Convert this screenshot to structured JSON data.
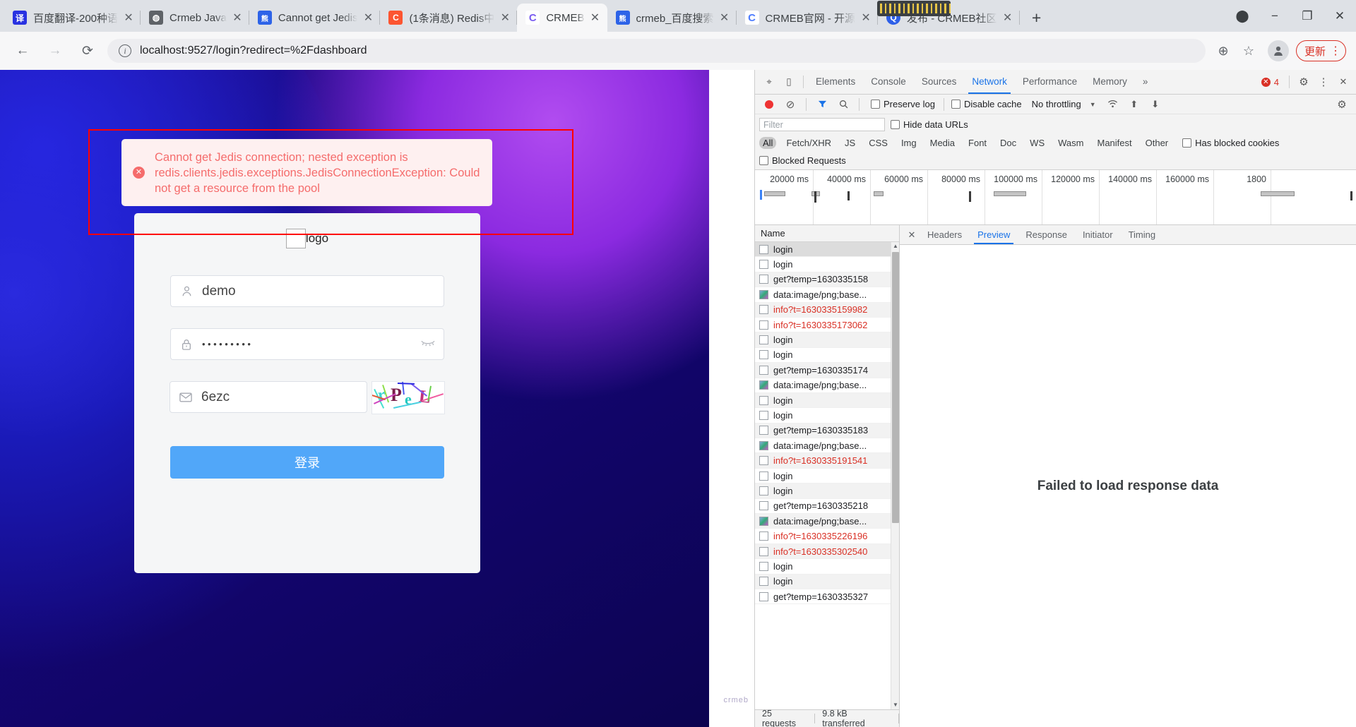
{
  "browser": {
    "tabs": [
      {
        "title": "百度翻译-200种语",
        "favicon_text": "译",
        "favicon_color": "#2932e1",
        "active": false
      },
      {
        "title": "Crmeb Java",
        "favicon_text": "◍",
        "favicon_color": "#5f6368",
        "active": false
      },
      {
        "title": "Cannot get Jedis",
        "favicon_text": "熊",
        "favicon_color": "#2d63e8",
        "active": false
      },
      {
        "title": "(1条消息) Redis中",
        "favicon_text": "C",
        "favicon_color": "#fc5531",
        "active": false
      },
      {
        "title": "CRMEB",
        "favicon_text": "C",
        "favicon_color": "#7a5cf0",
        "active": true
      },
      {
        "title": "crmeb_百度搜索",
        "favicon_text": "熊",
        "favicon_color": "#2d63e8",
        "active": false
      },
      {
        "title": "CRMEB官网 - 开源",
        "favicon_text": "C",
        "favicon_color": "#4d7cfe",
        "active": false
      },
      {
        "title": "发布 - CRMEB社区",
        "favicon_text": "Q",
        "favicon_color": "#2d5fe8",
        "active": false
      }
    ],
    "new_tab_label": "+",
    "close_label": "✕",
    "window_controls": {
      "extension": "⬤",
      "minimize": "−",
      "maximize": "❐",
      "close": "✕"
    },
    "nav": {
      "back": "←",
      "forward": "→",
      "reload": "⟳",
      "info_icon": "i",
      "url": "localhost:9527/login?redirect=%2Fdashboard",
      "zoom_icon": "⊕",
      "bookmark_icon": "☆",
      "profile_icon": "👤",
      "update_label": "更新",
      "menu_icon": "⋮"
    }
  },
  "page": {
    "toast": {
      "icon": "✕",
      "message": "Cannot get Jedis connection; nested exception is redis.clients.jedis.exceptions.JedisConnectionException: Could not get a resource from the pool",
      "text_color": "#f56c6c",
      "bg_color": "#fef0f0",
      "highlight_border": "#ff0000"
    },
    "login": {
      "logo_alt": "logo",
      "username": {
        "icon": "user-icon",
        "value": "demo"
      },
      "password": {
        "icon": "lock-icon",
        "value": "•••••••••",
        "toggle_icon": "eye-off-icon"
      },
      "captcha": {
        "icon": "mail-icon",
        "value": "6ezc",
        "image_text": "rPeL"
      },
      "submit_label": "登录",
      "submit_color": "#51a7f9"
    },
    "watermark": "crmeb"
  },
  "devtools": {
    "inspect_icon": "⌖",
    "device_icon": "▯",
    "tabs": [
      {
        "label": "Elements",
        "active": false
      },
      {
        "label": "Console",
        "active": false
      },
      {
        "label": "Sources",
        "active": false
      },
      {
        "label": "Network",
        "active": true
      },
      {
        "label": "Performance",
        "active": false
      },
      {
        "label": "Memory",
        "active": false
      }
    ],
    "more_tabs_icon": "»",
    "error_count": "4",
    "error_dot": "✕",
    "settings_icon": "⚙",
    "menu_icon": "⋮",
    "close_icon": "✕",
    "controls": {
      "record_title": "record",
      "clear_icon": "⊘",
      "filter_icon": "▼",
      "search_icon": "🔍",
      "preserve_log": "Preserve log",
      "disable_cache": "Disable cache",
      "throttling": "No throttling",
      "throttling_caret": "▼",
      "wifi_icon": "((•))",
      "upload_icon": "⬆",
      "download_icon": "⬇",
      "net_settings_icon": "⚙"
    },
    "filter": {
      "placeholder": "Filter",
      "hide_data_urls": "Hide data URLs",
      "blocked_requests": "Blocked Requests",
      "has_blocked_cookies": "Has blocked cookies"
    },
    "types": [
      "All",
      "Fetch/XHR",
      "JS",
      "CSS",
      "Img",
      "Media",
      "Font",
      "Doc",
      "WS",
      "Wasm",
      "Manifest",
      "Other"
    ],
    "overview": {
      "ticks": [
        "20000 ms",
        "40000 ms",
        "60000 ms",
        "80000 ms",
        "100000 ms",
        "120000 ms",
        "140000 ms",
        "160000 ms",
        "1800"
      ]
    },
    "requests": {
      "column_header": "Name",
      "rows": [
        {
          "name": "login",
          "kind": "doc",
          "error": false,
          "selected": true
        },
        {
          "name": "login",
          "kind": "doc",
          "error": false
        },
        {
          "name": "get?temp=1630335158",
          "kind": "doc",
          "error": false
        },
        {
          "name": "data:image/png;base...",
          "kind": "img",
          "error": false
        },
        {
          "name": "info?t=1630335159982",
          "kind": "doc",
          "error": true
        },
        {
          "name": "info?t=1630335173062",
          "kind": "doc",
          "error": true
        },
        {
          "name": "login",
          "kind": "doc",
          "error": false
        },
        {
          "name": "login",
          "kind": "doc",
          "error": false
        },
        {
          "name": "get?temp=1630335174",
          "kind": "doc",
          "error": false
        },
        {
          "name": "data:image/png;base...",
          "kind": "img",
          "error": false
        },
        {
          "name": "login",
          "kind": "doc",
          "error": false
        },
        {
          "name": "login",
          "kind": "doc",
          "error": false
        },
        {
          "name": "get?temp=1630335183",
          "kind": "doc",
          "error": false
        },
        {
          "name": "data:image/png;base...",
          "kind": "img",
          "error": false
        },
        {
          "name": "info?t=1630335191541",
          "kind": "doc",
          "error": true
        },
        {
          "name": "login",
          "kind": "doc",
          "error": false
        },
        {
          "name": "login",
          "kind": "doc",
          "error": false
        },
        {
          "name": "get?temp=1630335218",
          "kind": "doc",
          "error": false
        },
        {
          "name": "data:image/png;base...",
          "kind": "img",
          "error": false
        },
        {
          "name": "info?t=1630335226196",
          "kind": "doc",
          "error": true
        },
        {
          "name": "info?t=1630335302540",
          "kind": "doc",
          "error": true
        },
        {
          "name": "login",
          "kind": "doc",
          "error": false
        },
        {
          "name": "login",
          "kind": "doc",
          "error": false
        },
        {
          "name": "get?temp=1630335327",
          "kind": "doc",
          "error": false
        }
      ],
      "status": {
        "requests": "25 requests",
        "transferred": "9.8 kB transferred"
      }
    },
    "detail": {
      "close_icon": "✕",
      "tabs": [
        {
          "label": "Headers",
          "active": false
        },
        {
          "label": "Preview",
          "active": true
        },
        {
          "label": "Response",
          "active": false
        },
        {
          "label": "Initiator",
          "active": false
        },
        {
          "label": "Timing",
          "active": false
        }
      ],
      "body_message": "Failed to load response data"
    }
  }
}
